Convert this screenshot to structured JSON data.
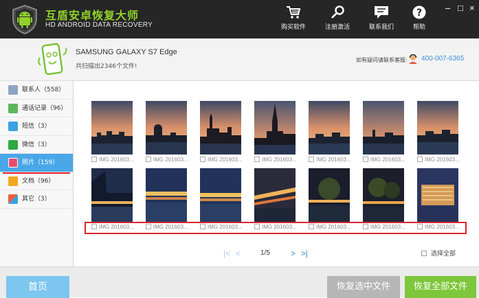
{
  "app": {
    "title": "互盾安卓恢复大师",
    "subtitle": "HD ANDROID DATA RECOVERY"
  },
  "toolbar": {
    "buy": "购买软件",
    "register": "注册激活",
    "contact": "联系我们",
    "help": "帮助"
  },
  "window": {
    "minimize": "–",
    "maximize": "□",
    "close": "×"
  },
  "device": {
    "name": "SAMSUNG GALAXY S7 Edge",
    "scan_count": "共扫描出2346个文件!"
  },
  "support": {
    "label": "如有疑问请联系客服:",
    "phone": "400-007-6365"
  },
  "sidebar": {
    "items": [
      {
        "label": "联系人（558）",
        "color": "#8fa3c2"
      },
      {
        "label": "通话记录（96）",
        "color": "#5cb85c"
      },
      {
        "label": "短信（3）",
        "color": "#3ba1e3"
      },
      {
        "label": "微信（3）",
        "color": "#2ea843"
      },
      {
        "label": "照片（159）",
        "color": "#e84c6e"
      },
      {
        "label": "文档（96）",
        "color": "#f0a81e"
      },
      {
        "label": "其它（3）",
        "color": "#e8613c"
      }
    ]
  },
  "photos": {
    "row1": [
      "IMG 201603...",
      "IMG 201603...",
      "IMG 201603...",
      "IMG 201603...",
      "IMG 201603...",
      "IMG 201603...",
      "IMG 201603..."
    ],
    "row2": [
      "IMG 201603...",
      "IMG 201603...",
      "IMG 201603...",
      "IMG 201603...",
      "IMG 201603...",
      "IMG 201603...",
      "IMG 201603..."
    ]
  },
  "pager": {
    "first": "|<",
    "prev": "<",
    "page": "1/5",
    "next": ">",
    "last": ">|"
  },
  "select_all": "选择全部",
  "bottom": {
    "home": "首页",
    "recover_selected": "恢复选中文件",
    "recover_all": "恢复全部文件"
  }
}
